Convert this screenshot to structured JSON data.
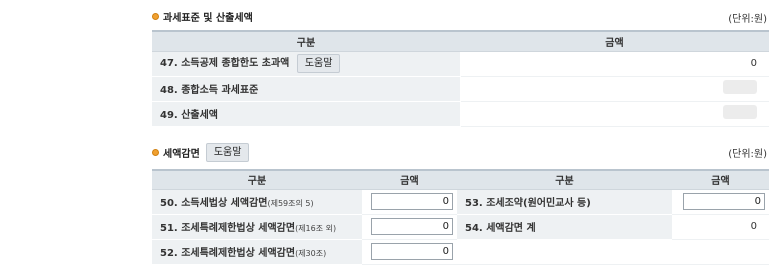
{
  "section1": {
    "title": "과세표준 및 산출세액",
    "unit": "(단위:원)",
    "col_headers": [
      "구분",
      "금액"
    ],
    "rows": [
      {
        "label": "47. 소득공제 종합한도 초과액",
        "help": "도움말",
        "value": "0"
      },
      {
        "label": "48. 종합소득 과세표준",
        "value": ""
      },
      {
        "label": "49. 산출세액",
        "value": ""
      }
    ]
  },
  "section2": {
    "title": "세액감면",
    "help": "도움말",
    "unit": "(단위:원)",
    "col_headers": [
      "구분",
      "금액",
      "구분",
      "금액"
    ],
    "rows": [
      {
        "left_label": "50. 소득세법상 세액감면",
        "left_note": "(제59조의 5)",
        "left_value": "0",
        "right_label": "53. 조세조약(원어민교사 등)",
        "right_value": "0"
      },
      {
        "left_label": "51. 조세특례제한법상 세액감면",
        "left_note": "(제16조 외)",
        "left_value": "0",
        "right_label": "54. 세액감면 계",
        "right_value": "0"
      },
      {
        "left_label": "52. 조세특례제한법상 세액감면",
        "left_note": "(제30조)",
        "left_value": "0",
        "right_label": "",
        "right_value": ""
      }
    ]
  }
}
